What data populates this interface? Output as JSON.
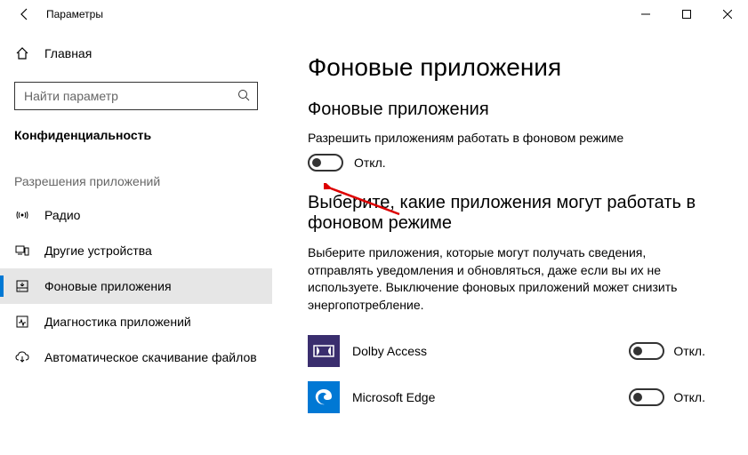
{
  "window": {
    "title": "Параметры"
  },
  "sidebar": {
    "home_label": "Главная",
    "search_placeholder": "Найти параметр",
    "category": "Конфиденциальность",
    "group": "Разрешения приложений",
    "items": [
      {
        "label": "Радио"
      },
      {
        "label": "Другие устройства"
      },
      {
        "label": "Фоновые приложения"
      },
      {
        "label": "Диагностика приложений"
      },
      {
        "label": "Автоматическое скачивание файлов"
      }
    ]
  },
  "main": {
    "title": "Фоновые приложения",
    "section1_title": "Фоновые приложения",
    "allow_label": "Разрешить приложениям работать в фоновом режиме",
    "master_state": "Откл.",
    "section2_title": "Выберите, какие приложения могут работать в фоновом режиме",
    "description": "Выберите приложения, которые могут получать сведения, отправлять уведомления и обновляться, даже если вы их не используете. Выключение фоновых приложений может снизить энергопотребление.",
    "apps": [
      {
        "name": "Dolby Access",
        "state": "Откл."
      },
      {
        "name": "Microsoft Edge",
        "state": "Откл."
      }
    ]
  }
}
